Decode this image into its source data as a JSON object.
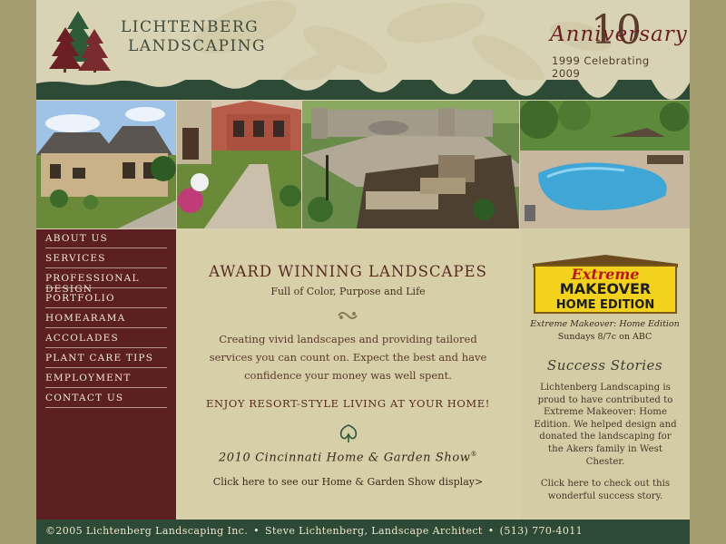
{
  "header": {
    "brand_line1": "LICHTENBERG",
    "brand_line2": "LANDSCAPING",
    "anniversary_number": "10",
    "anniversary_script": "Anniversary",
    "anniversary_years": "1999  Celebrating  2009"
  },
  "photos": [
    {
      "name": "house-photo"
    },
    {
      "name": "walkway-photo"
    },
    {
      "name": "patio-photo"
    },
    {
      "name": "pool-photo"
    }
  ],
  "nav": {
    "items": [
      {
        "label": "ABOUT US"
      },
      {
        "label": "SERVICES"
      },
      {
        "label": "PROFESSIONAL DESIGN"
      },
      {
        "label": "PORTFOLIO"
      },
      {
        "label": "HOMEARAMA"
      },
      {
        "label": "ACCOLADES"
      },
      {
        "label": "PLANT CARE TIPS"
      },
      {
        "label": "EMPLOYMENT"
      },
      {
        "label": "CONTACT US"
      }
    ]
  },
  "main": {
    "heading": "AWARD WINNING LANDSCAPES",
    "subheading": "Full of Color, Purpose and Life",
    "paragraph": "Creating vivid landscapes and providing tailored services you can count on. Expect the best and have confidence your money was well spent.",
    "resort": "ENJOY RESORT-STYLE LIVING AT YOUR HOME!",
    "show_title": "2010 Cincinnati Home & Garden Show",
    "show_reg": "®",
    "show_link": "Click here to see our Home & Garden Show display>"
  },
  "sidebar": {
    "makeover_line1": "Extreme",
    "makeover_line2": "MAKEOVER",
    "makeover_line3": "HOME EDITION",
    "caption_show": "Extreme Makeover: Home Edition",
    "caption_time": "Sundays 8/7c on ABC",
    "success_title": "Success Stories",
    "story": "Lichtenberg Landscaping is proud to have contributed to Extreme Makeover: Home Edition. We helped design and donated the landscaping for the Akers family in West Chester.",
    "story_link": "Click here to check out this wonderful success story."
  },
  "footer": {
    "copyright": "©2005 Lichtenberg Landscaping Inc.",
    "architect": "Steve Lichtenberg, Landscape Architect",
    "phone": "(513) 770-4011"
  },
  "colors": {
    "nav_bg": "#5c1f22",
    "footer_bg": "#2c4a35",
    "header_bg": "#d9d3b5",
    "outer_bg": "#a39d6f"
  }
}
